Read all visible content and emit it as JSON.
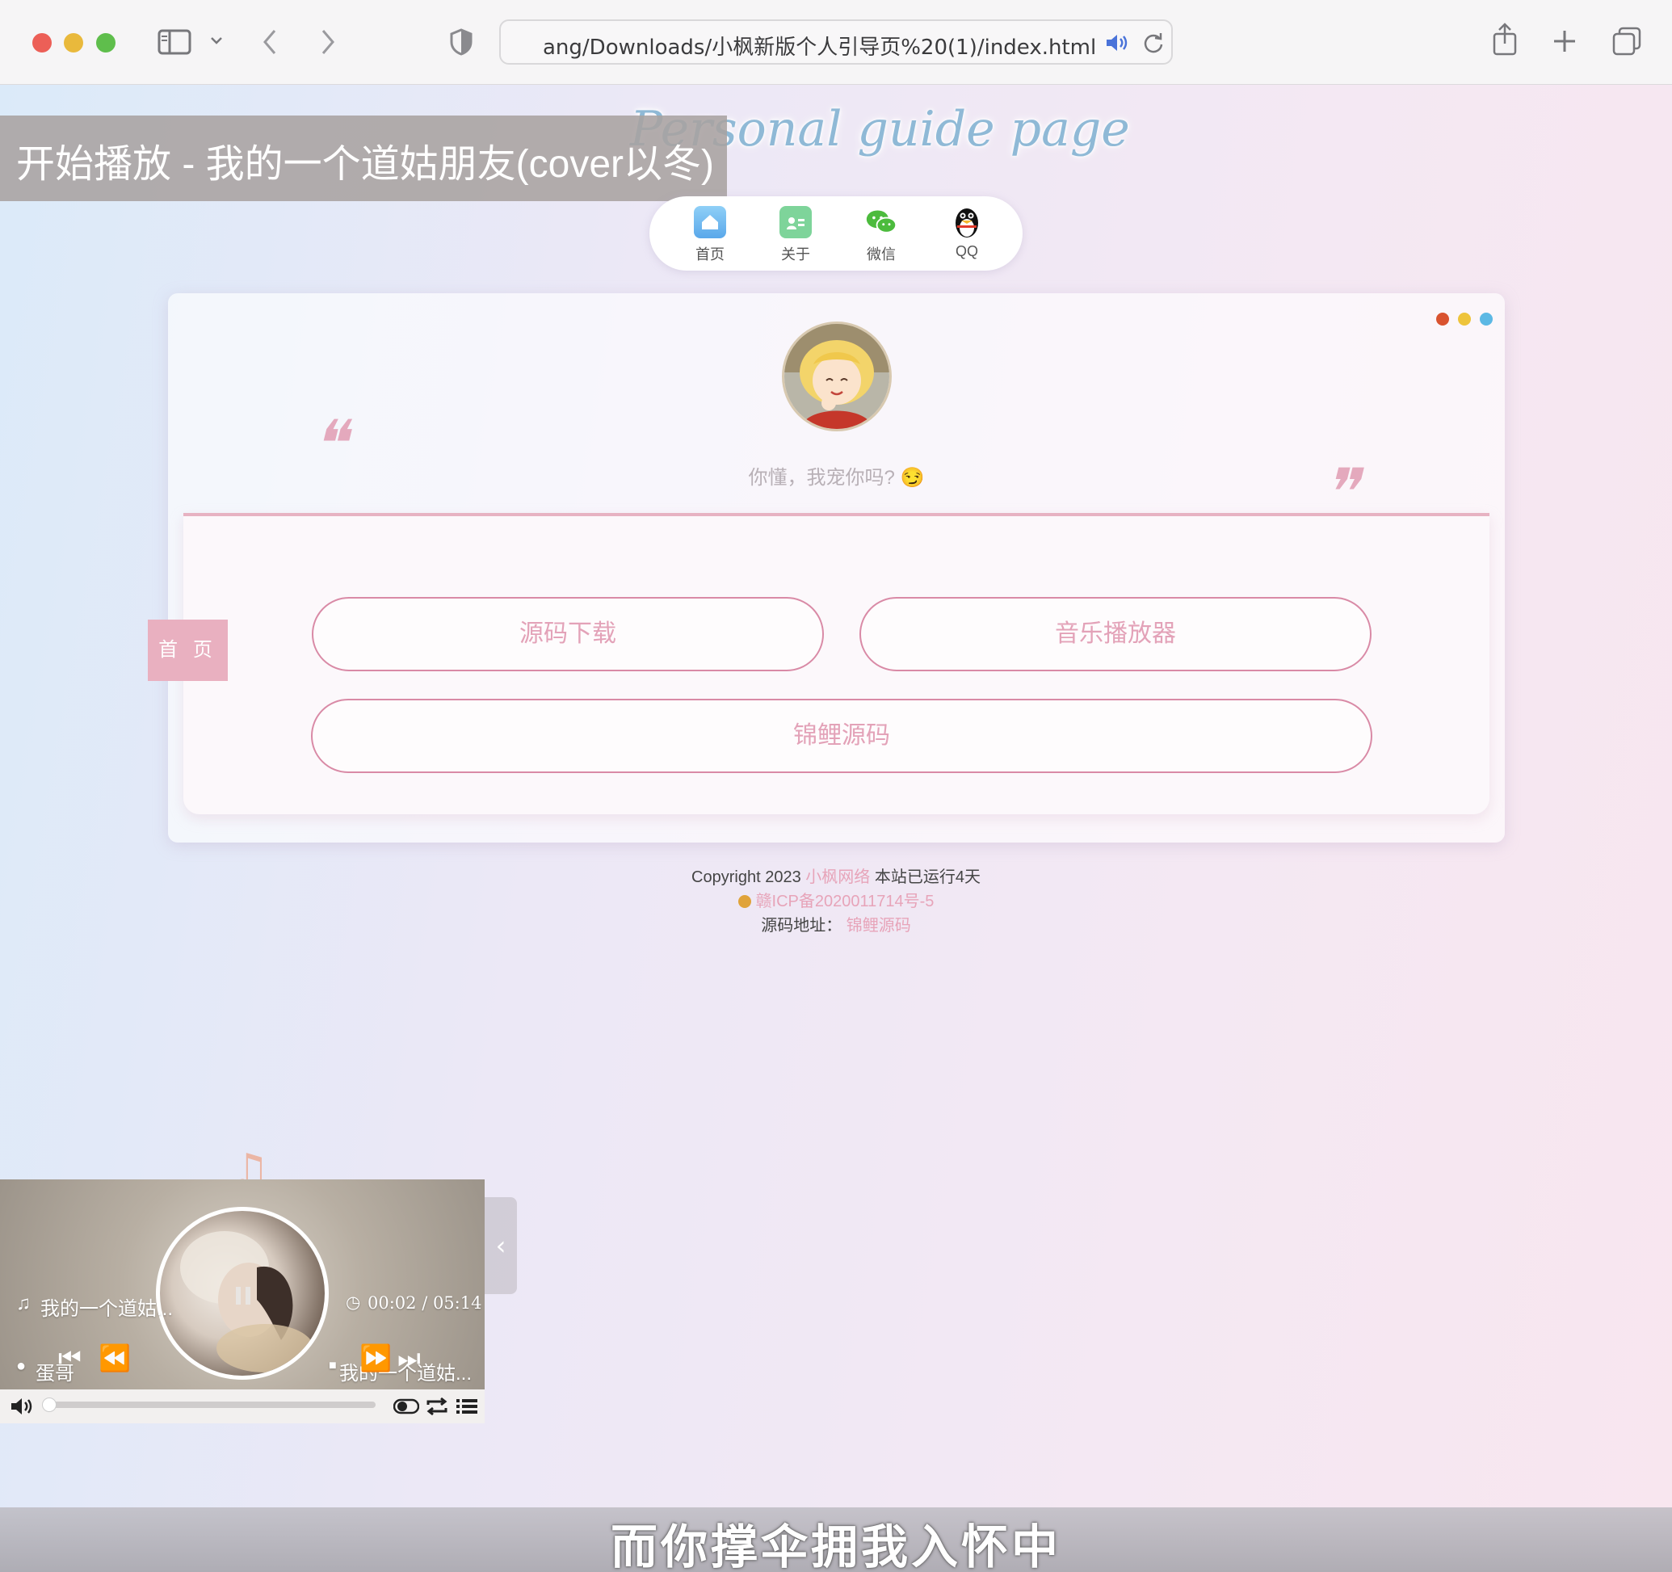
{
  "browser": {
    "address": "ang/Downloads/小枫新版个人引导页%20(1)/index.html"
  },
  "page": {
    "title": "Personal guide page",
    "toast": "开始播放 - 我的一个道姑朋友(cover以冬)"
  },
  "nav": {
    "items": [
      {
        "label": "首页",
        "icon": "home-icon",
        "color": "#6ab8f0"
      },
      {
        "label": "关于",
        "icon": "calendar-contact-icon",
        "color": "#6fcf8a"
      },
      {
        "label": "微信",
        "icon": "wechat-icon",
        "color": "#4cbb3d"
      },
      {
        "label": "QQ",
        "icon": "qq-penguin-icon",
        "color": "#111111"
      }
    ]
  },
  "card": {
    "motto": "你懂，我宠你吗? 😏",
    "home_tab": "首 页",
    "buttons": {
      "source_download": "源码下载",
      "music_player": "音乐播放器",
      "koi_source": "锦鲤源码"
    },
    "dot_colors": [
      "#d9532f",
      "#eec43b",
      "#5cb8e4"
    ]
  },
  "footer": {
    "copyright_prefix": "Copyright 2023",
    "site_name": "小枫网络",
    "running": "本站已运行4天",
    "icp": "赣ICP备2020011714号-5",
    "source_label": "源码地址：",
    "source_link": "锦鲤源码"
  },
  "player": {
    "song": "我的一个道姑...",
    "time": "00:02 / 05:14",
    "artist": "蛋哥",
    "album": "我的一个道姑..."
  },
  "subtitle": "而你撑伞拥我入怀中",
  "colors": {
    "accent_pink": "#e3a2b8",
    "title_blue": "#8fb9d6"
  }
}
